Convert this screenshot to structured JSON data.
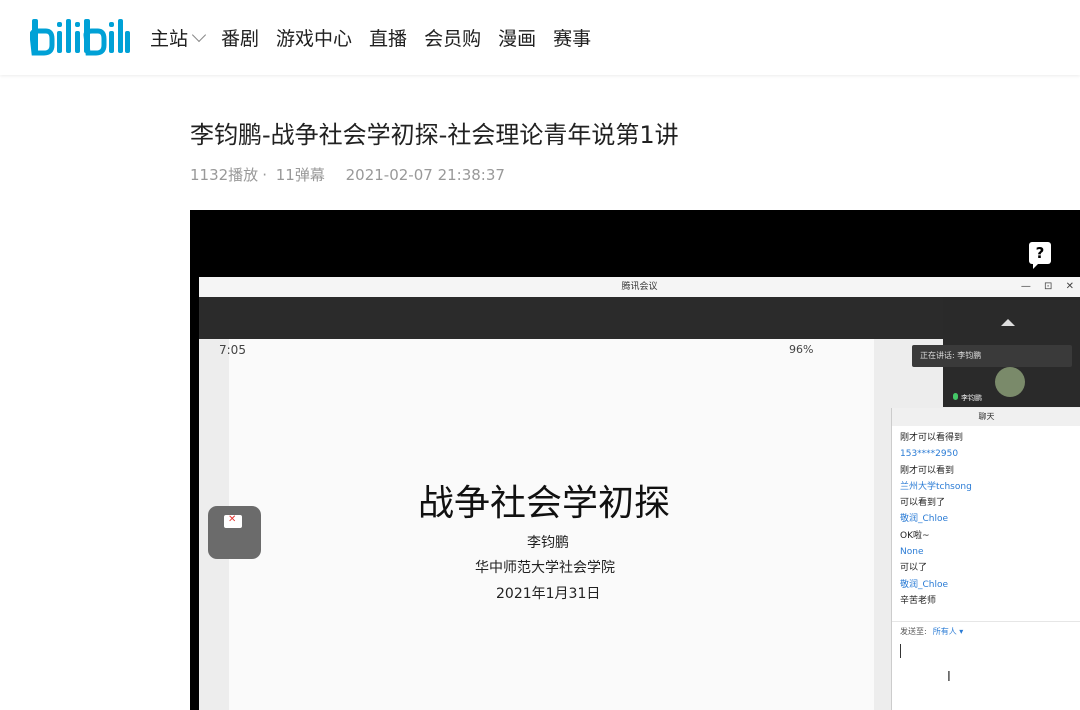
{
  "header": {
    "logo_text": "bilibili",
    "nav": [
      "主站",
      "番剧",
      "游戏中心",
      "直播",
      "会员购",
      "漫画",
      "赛事"
    ]
  },
  "video": {
    "title": "李钧鹏-战争社会学初探-社会理论青年说第1讲",
    "plays": "1132播放",
    "separator": "·",
    "danmaku": "11弹幕",
    "datetime": "2021-02-07 21:38:37"
  },
  "player": {
    "help_label": "?",
    "meeting": {
      "window_title": "腾讯会议",
      "window_controls": [
        "—",
        "⊡",
        "✕"
      ],
      "phone_status_left": "7:05",
      "phone_status_right": "96%",
      "slide": {
        "title": "战争社会学初探",
        "author": "李钧鹏",
        "institution": "华中师范大学社会学院",
        "date": "2021年1月31日"
      },
      "speaking_label": "正在讲话: 李钧鹏",
      "participant_name": "李钧鹏",
      "chat": {
        "header": "聊天",
        "messages": [
          {
            "type": "text",
            "value": "刚才可以看得到"
          },
          {
            "type": "name",
            "value": "153****2950"
          },
          {
            "type": "text",
            "value": "刚才可以看到"
          },
          {
            "type": "name",
            "value": "兰州大学tchsong"
          },
          {
            "type": "text",
            "value": "可以看到了"
          },
          {
            "type": "name",
            "value": "敬润_Chloe"
          },
          {
            "type": "text",
            "value": "OK啦~"
          },
          {
            "type": "name",
            "value": "None"
          },
          {
            "type": "text",
            "value": "可以了"
          },
          {
            "type": "name",
            "value": "敬润_Chloe"
          },
          {
            "type": "text",
            "value": "辛苦老师"
          }
        ],
        "send_to_label": "发送至:",
        "send_to_value": "所有人 ▾"
      }
    }
  },
  "colors": {
    "brand_blue": "#00a1d6",
    "chat_name_blue": "#2a7bd5"
  }
}
